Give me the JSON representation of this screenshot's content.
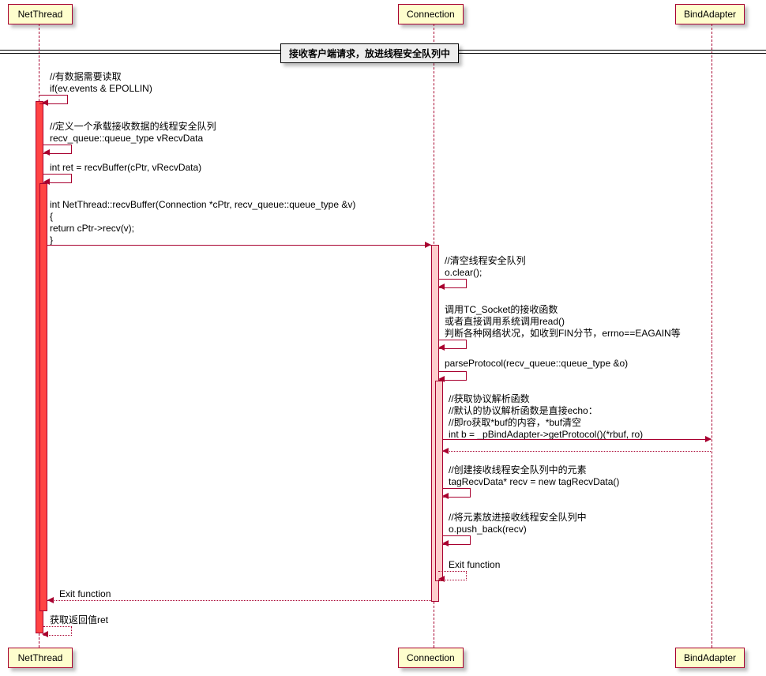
{
  "participants": {
    "net_thread": "NetThread",
    "connection": "Connection",
    "bind_adapter": "BindAdapter"
  },
  "divider_title": "接收客户端请求，放进线程安全队列中",
  "messages": {
    "m1_l1": "//有数据需要读取",
    "m1_l2": "if(ev.events & EPOLLIN)",
    "m2_l1": "//定义一个承载接收数据的线程安全队列",
    "m2_l2": "recv_queue::queue_type vRecvData",
    "m3": "int ret = recvBuffer(cPtr, vRecvData)",
    "m4_l1": "int NetThread::recvBuffer(Connection *cPtr, recv_queue::queue_type &v)",
    "m4_l2": "{",
    "m4_l3": "    return cPtr->recv(v);",
    "m4_l4": "}",
    "m5_l1": "//清空线程安全队列",
    "m5_l2": "o.clear();",
    "m6_l1": "调用TC_Socket的接收函数",
    "m6_l2": "或者直接调用系统调用read()",
    "m6_l3": "判断各种网络状况，如收到FIN分节，errno==EAGAIN等",
    "m7": "parseProtocol(recv_queue::queue_type &o)",
    "m8_l1": "//获取协议解析函数",
    "m8_l2": "//默认的协议解析函数是直接echo：",
    "m8_l3": "//即ro获取*buf的内容，*buf清空",
    "m8_l4": "int b = _pBindAdapter->getProtocol()(*rbuf, ro)",
    "m9_l1": "//创建接收线程安全队列中的元素",
    "m9_l2": "tagRecvData* recv = new tagRecvData()",
    "m10_l1": "//将元素放进接收线程安全队列中",
    "m10_l2": "o.push_back(recv)",
    "m11": "Exit function",
    "m12": "Exit function",
    "m13": "获取返回值ret"
  }
}
